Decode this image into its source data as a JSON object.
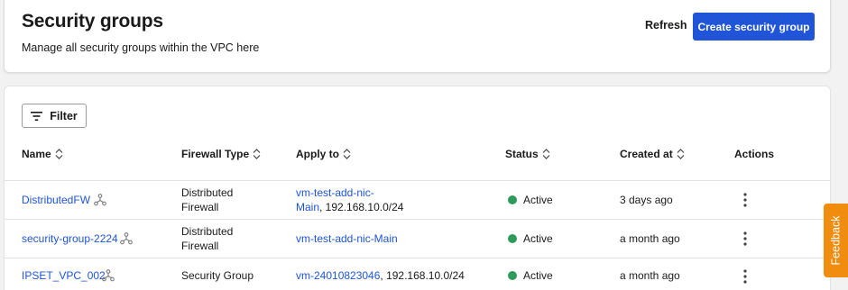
{
  "header": {
    "title": "Security groups",
    "subtitle": "Manage all security groups within the VPC here",
    "refresh_label": "Refresh",
    "create_label": "Create security group"
  },
  "toolbar": {
    "filter_label": "Filter"
  },
  "table": {
    "columns": [
      "Name",
      "Firewall Type",
      "Apply to",
      "Status",
      "Created at",
      "Actions"
    ],
    "rows": [
      {
        "name": "DistributedFW",
        "firewall_type_line1": "Distributed",
        "firewall_type_line2": "Firewall",
        "apply_link_line1": "vm-test-add-nic-",
        "apply_link_line2": "Main",
        "apply_suffix": ", 192.168.10.0/24",
        "status": "Active",
        "created_at": "3 days ago"
      },
      {
        "name": "security-group-2224",
        "firewall_type_line1": "Distributed",
        "firewall_type_line2": "Firewall",
        "apply_link": "vm-test-add-nic-Main",
        "status": "Active",
        "created_at": "a month ago"
      },
      {
        "name": "IPSET_VPC_002",
        "firewall_type": "Security Group",
        "apply_link": "vm-24010823046",
        "apply_suffix": ", 192.168.10.0/24",
        "status": "Active",
        "created_at": "a month ago"
      }
    ]
  },
  "feedback_label": "Feedback",
  "colors": {
    "primary": "#1f55d6",
    "link": "#1f55d6",
    "status_active": "#2e9a5c",
    "feedback": "#f08c0e"
  },
  "icons": [
    "filter-icon",
    "sort-icon",
    "network-icon",
    "kebab-menu-icon"
  ]
}
